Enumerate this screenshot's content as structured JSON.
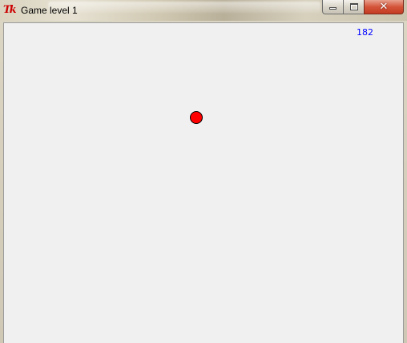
{
  "window": {
    "title": "Game level 1",
    "app_icon": "tk-feather-icon",
    "app_icon_text": "Tk",
    "caption_buttons": {
      "minimize_icon": "minimize-icon",
      "maximize_icon": "maximize-icon",
      "close_icon": "close-icon",
      "close_glyph": "✕"
    }
  },
  "game": {
    "score": "182",
    "score_color": "#0000ff",
    "ball_color": "#ff0000",
    "ball_outline_color": "#000000",
    "canvas_background": "#f0f0f0"
  }
}
